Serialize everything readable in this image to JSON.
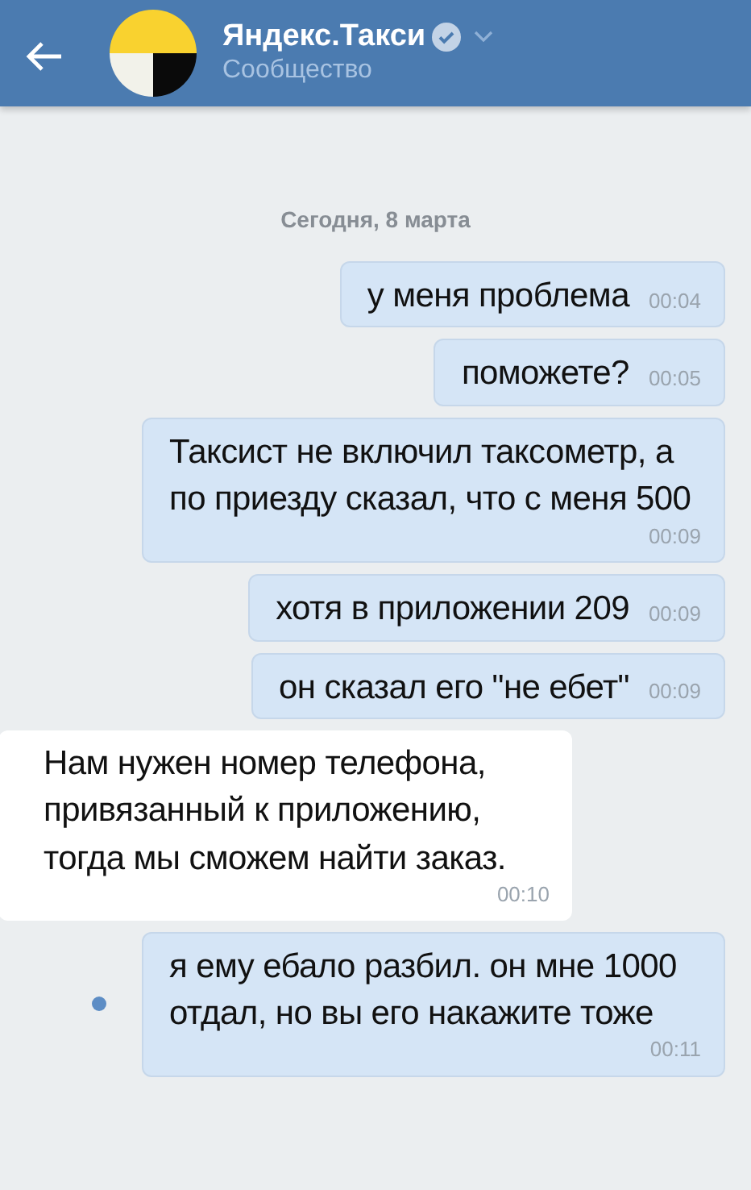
{
  "header": {
    "title": "Яндекс.Такси",
    "verified": true,
    "subtitle": "Сообщество"
  },
  "date_separator": "Сегодня, 8 марта",
  "messages": [
    {
      "kind": "outgoing",
      "text": "у меня проблема",
      "time": "00:04",
      "unread": false
    },
    {
      "kind": "outgoing",
      "text": "поможете?",
      "time": "00:05",
      "unread": false
    },
    {
      "kind": "outgoing",
      "text": "Таксист не включил таксометр, а по приезду сказал, что с меня 500",
      "time": "00:09",
      "unread": false
    },
    {
      "kind": "outgoing",
      "text": "хотя в приложении 209",
      "time": "00:09",
      "unread": false
    },
    {
      "kind": "outgoing",
      "text": "он сказал его \"не ебет\"",
      "time": "00:09",
      "unread": false
    },
    {
      "kind": "incoming",
      "text": "Нам нужен номер телефона, привязанный к приложению, тогда мы сможем найти заказ.",
      "time": "00:10",
      "unread": false
    },
    {
      "kind": "outgoing",
      "text": "я ему ебало разбил. он мне 1000 отдал, но вы его накажите тоже",
      "time": "00:11",
      "unread": true
    }
  ]
}
